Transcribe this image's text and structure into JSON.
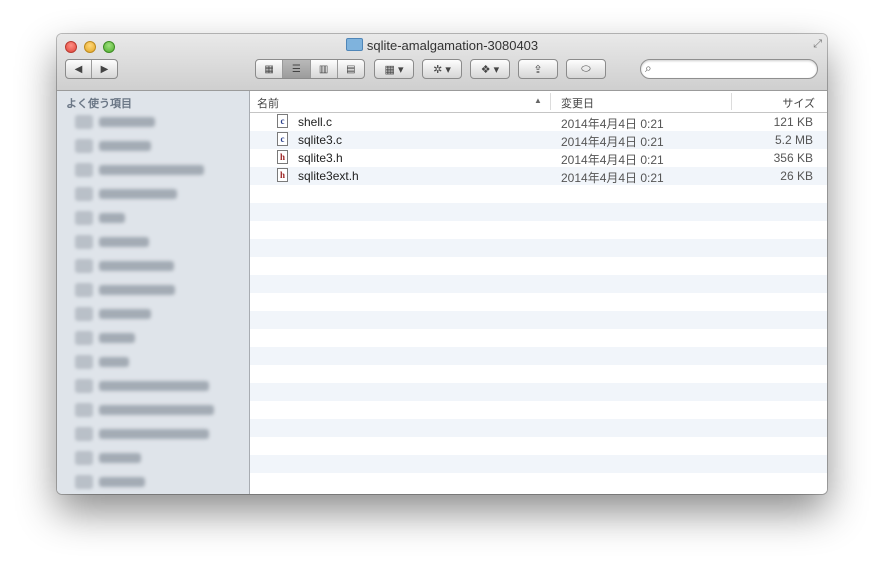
{
  "window": {
    "title": "sqlite-amalgamation-3080403",
    "title_icon": "folder-icon",
    "fullscreen_icon": "fullscreen-arrows-icon"
  },
  "toolbar": {
    "back": "◀",
    "forward": "▶",
    "view_icons": "▦",
    "view_list": "☰",
    "view_columns": "▥",
    "view_coverflow": "▤",
    "arrange": "▦ ▾",
    "action": "✲ ▾",
    "dropbox": "❖ ▾",
    "share": "⇪",
    "tags": "⬭",
    "search_placeholder": ""
  },
  "sidebar": {
    "header": "よく使う項目",
    "items": [
      {
        "blur_width": 56
      },
      {
        "blur_width": 52
      },
      {
        "blur_width": 105
      },
      {
        "blur_width": 78
      },
      {
        "blur_width": 26
      },
      {
        "blur_width": 50
      },
      {
        "blur_width": 75
      },
      {
        "blur_width": 76
      },
      {
        "blur_width": 52
      },
      {
        "blur_width": 36
      },
      {
        "blur_width": 30
      },
      {
        "blur_width": 110
      },
      {
        "blur_width": 115
      },
      {
        "blur_width": 110
      },
      {
        "blur_width": 42
      },
      {
        "blur_width": 46
      }
    ]
  },
  "columns": {
    "name": "名前",
    "date": "変更日",
    "size": "サイズ",
    "sort_indicator": "▲"
  },
  "files": [
    {
      "name": "shell.c",
      "type": "c",
      "date": "2014年4月4日 0:21",
      "size": "121 KB"
    },
    {
      "name": "sqlite3.c",
      "type": "c",
      "date": "2014年4月4日 0:21",
      "size": "5.2 MB"
    },
    {
      "name": "sqlite3.h",
      "type": "h",
      "date": "2014年4月4日 0:21",
      "size": "356 KB"
    },
    {
      "name": "sqlite3ext.h",
      "type": "h",
      "date": "2014年4月4日 0:21",
      "size": "26 KB"
    }
  ],
  "colors": {
    "sidebar_bg": "#dfe4ea",
    "stripe": "#f1f5fa",
    "titlebar_top": "#e9e9e9",
    "titlebar_bottom": "#cfcfcf"
  }
}
